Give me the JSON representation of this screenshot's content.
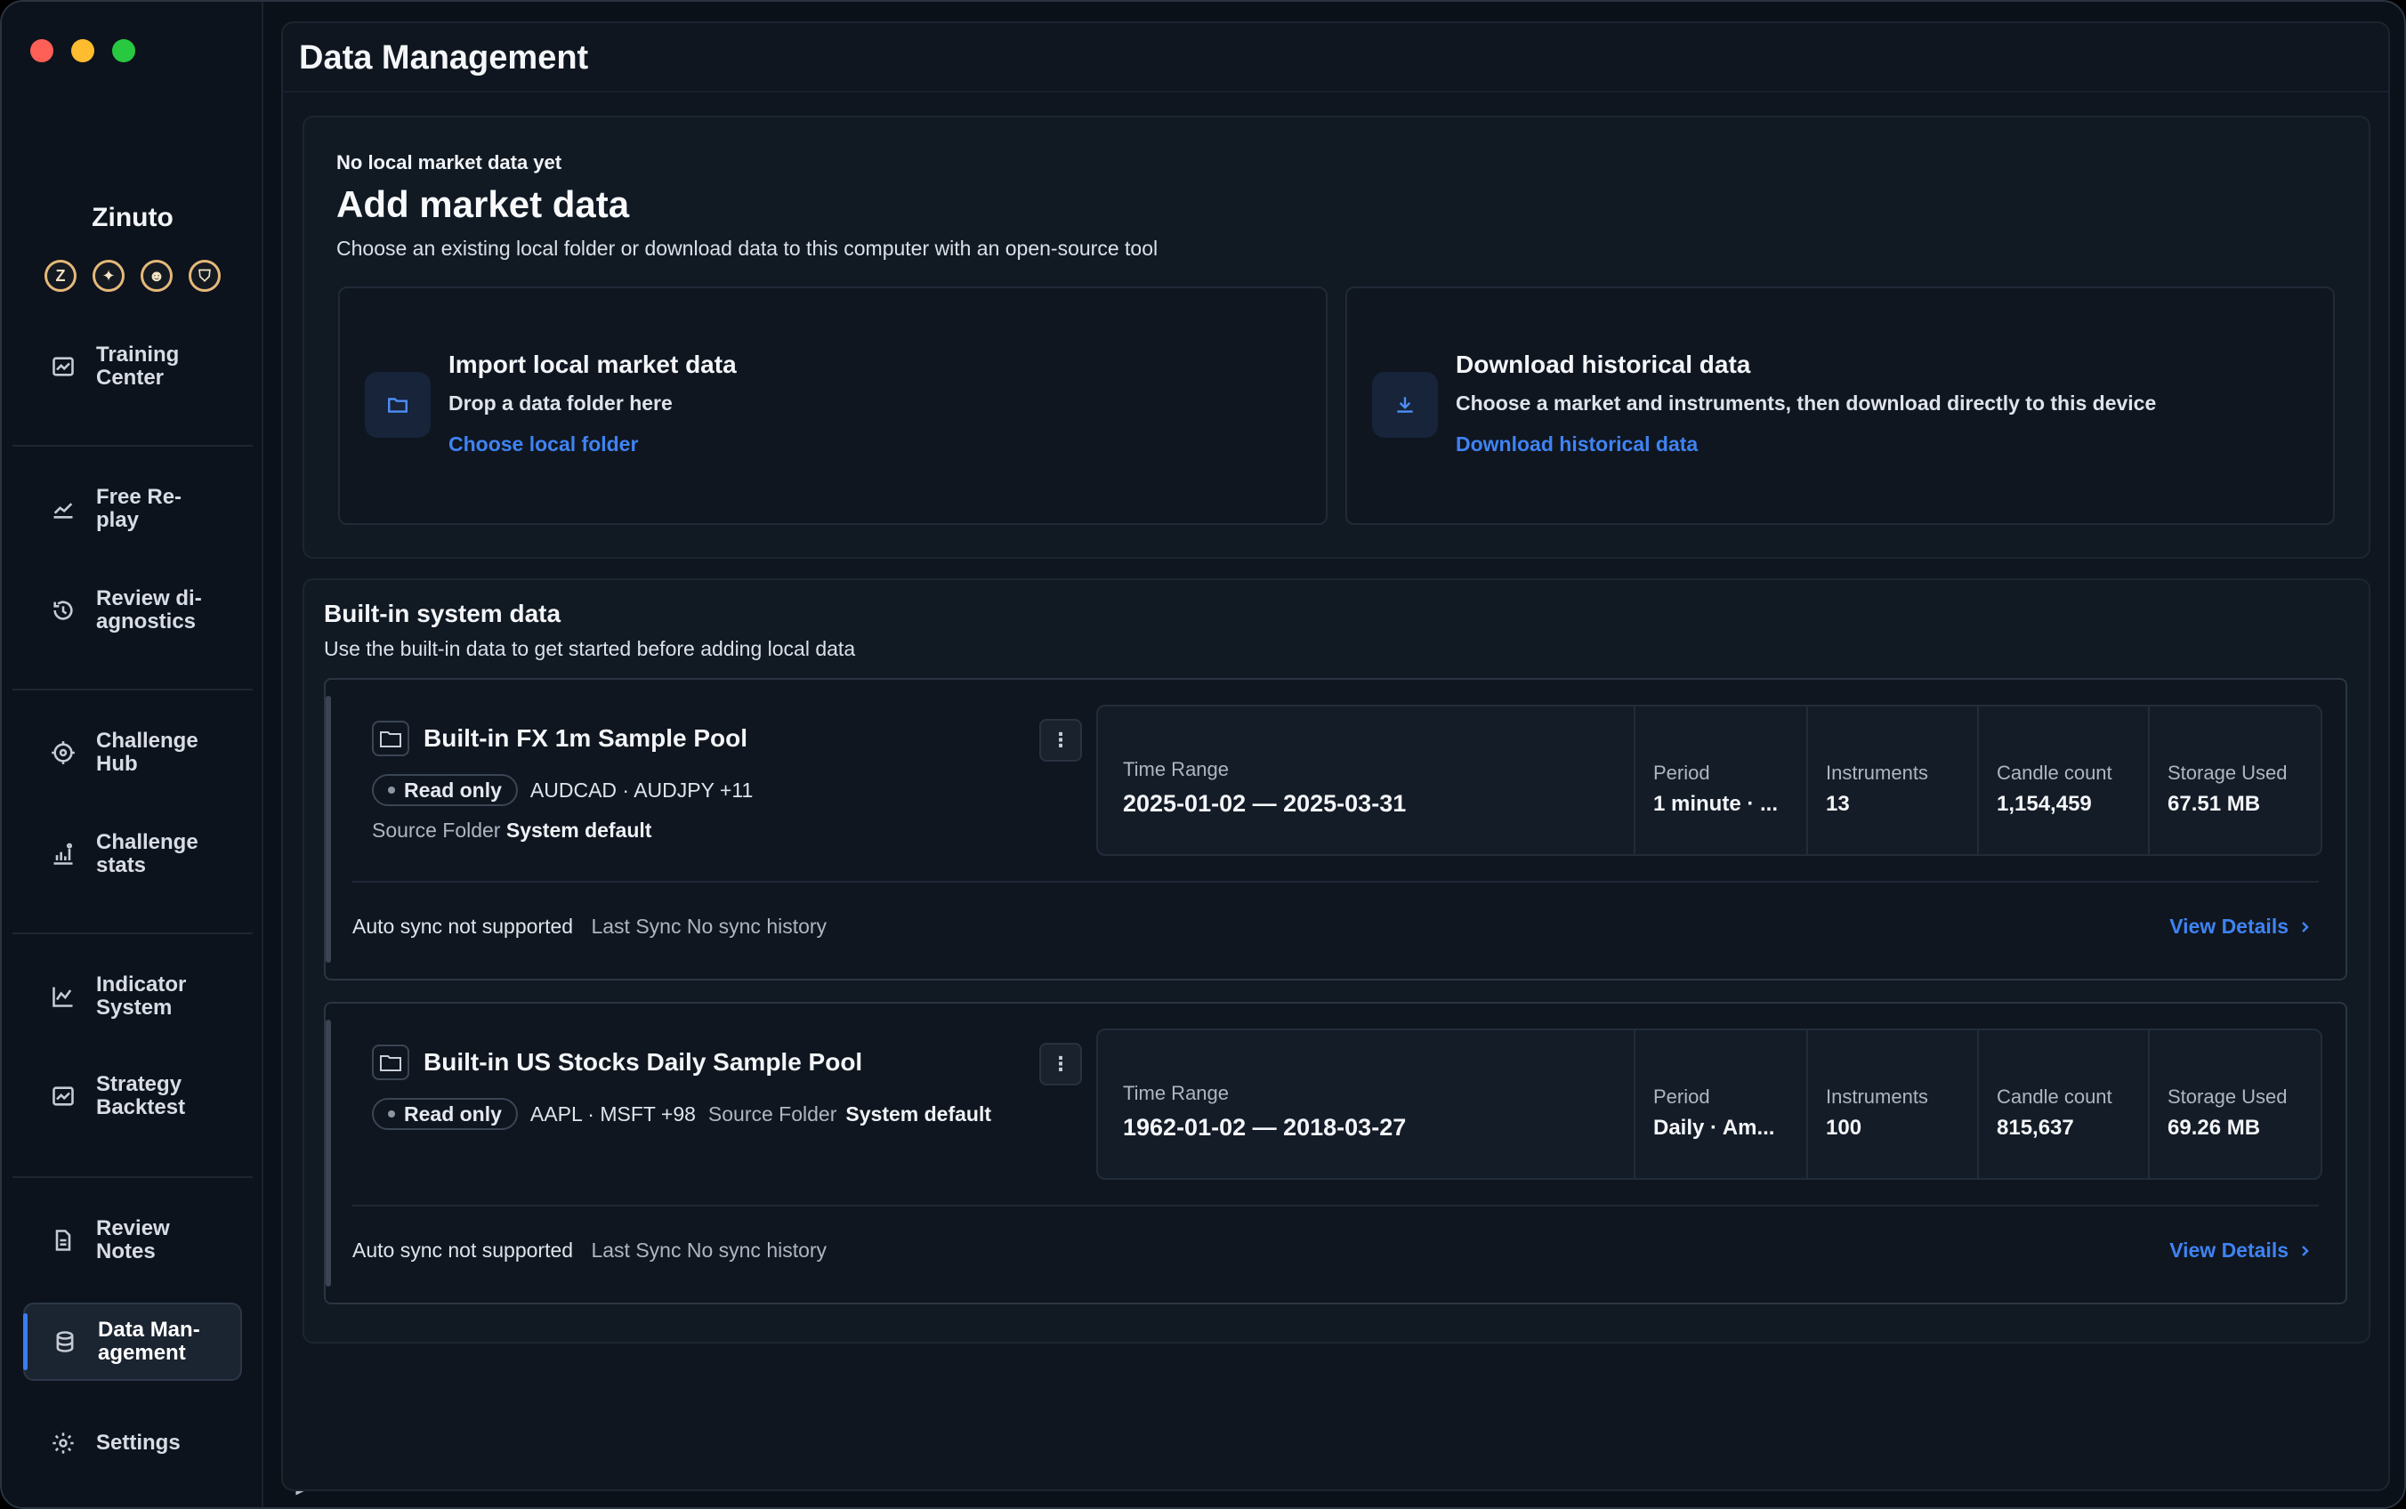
{
  "app": {
    "brand": "Zinuto",
    "brand_icons": [
      {
        "icon": "z-coin-icon",
        "glyph": "Z"
      },
      {
        "icon": "star-coin-icon",
        "glyph": "✦"
      },
      {
        "icon": "robot-coin-icon",
        "glyph": "☻"
      },
      {
        "icon": "shield-coin-icon",
        "glyph": "⛉"
      }
    ]
  },
  "sidebar": {
    "items": [
      {
        "label": "Training Center",
        "icon": "chart-card-icon"
      },
      {
        "label": "Free Re-play",
        "icon": "trend-line-icon"
      },
      {
        "label": "Review di-agnostics",
        "icon": "history-icon"
      },
      {
        "label": "Challenge Hub",
        "icon": "target-icon"
      },
      {
        "label": "Challenge stats",
        "icon": "bar-stats-icon"
      },
      {
        "label": "Indicator System",
        "icon": "line-chart-icon"
      },
      {
        "label": "Strategy Backtest",
        "icon": "chart-card-icon"
      },
      {
        "label": "Review Notes",
        "icon": "document-icon"
      },
      {
        "label": "Data Man-agement",
        "icon": "database-icon",
        "active": true
      },
      {
        "label": "Settings",
        "icon": "gear-icon"
      }
    ]
  },
  "page": {
    "title": "Data Management"
  },
  "add_data": {
    "eyebrow": "No local market data yet",
    "title": "Add market data",
    "subtitle": "Choose an existing local folder or download data to this computer with an open-source tool",
    "import": {
      "icon": "folder-icon",
      "title": "Import local market data",
      "desc": "Drop a data folder here",
      "link": "Choose local folder"
    },
    "download": {
      "icon": "download-icon",
      "title": "Download historical data",
      "desc": "Choose a market and instruments, then download directly to this device",
      "link": "Download historical data"
    }
  },
  "builtin": {
    "title": "Built-in system data",
    "subtitle": "Use the built-in data to get started before adding local data",
    "labels": {
      "read_only": "Read only",
      "source_folder": "Source Folder",
      "time_range": "Time Range",
      "period": "Period",
      "instruments": "Instruments",
      "candle_count": "Candle count",
      "storage_used": "Storage Used",
      "auto_sync": "Auto sync not supported",
      "last_sync": "Last Sync",
      "view_details": "View Details",
      "menu": "⋮"
    },
    "pools": [
      {
        "name": "Built-in FX 1m Sample Pool",
        "symbols": "AUDCAD · AUDJPY +11",
        "source": "System default",
        "time_range": "2025-01-02 — 2025-03-31",
        "period": "1 minute · ...",
        "instruments": "13",
        "candles": "1,154,459",
        "storage": "67.51 MB",
        "last_sync": "No sync history"
      },
      {
        "name": "Built-in US Stocks Daily Sample Pool",
        "symbols": "AAPL · MSFT +98",
        "source": "System default",
        "time_range": "1962-01-02 — 2018-03-27",
        "period": "Daily · Am...",
        "instruments": "100",
        "candles": "815,637",
        "storage": "69.26 MB",
        "last_sync": "No sync history"
      }
    ]
  },
  "colors": {
    "accent": "#3f83f2",
    "background": "#0b1119"
  }
}
